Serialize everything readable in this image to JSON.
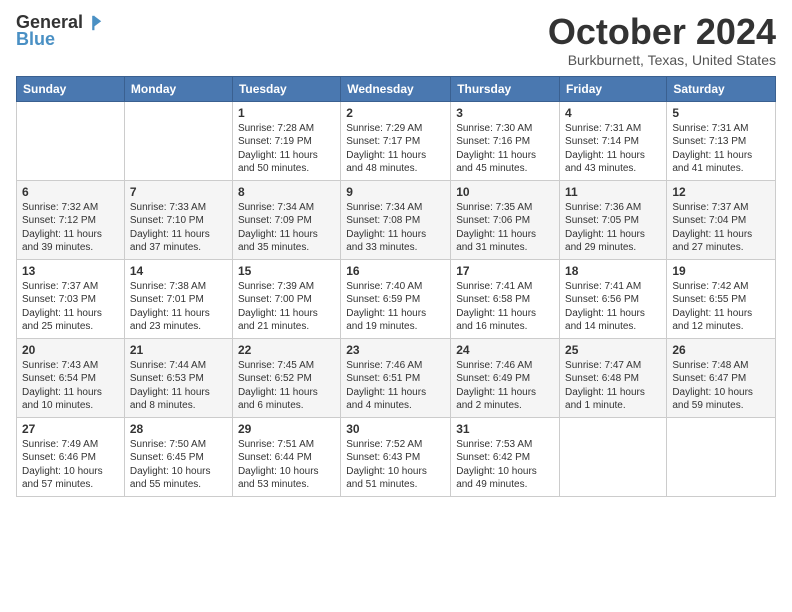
{
  "header": {
    "logo_general": "General",
    "logo_blue": "Blue",
    "main_title": "October 2024",
    "subtitle": "Burkburnett, Texas, United States"
  },
  "calendar": {
    "days_of_week": [
      "Sunday",
      "Monday",
      "Tuesday",
      "Wednesday",
      "Thursday",
      "Friday",
      "Saturday"
    ],
    "weeks": [
      [
        {
          "day": "",
          "info": ""
        },
        {
          "day": "",
          "info": ""
        },
        {
          "day": "1",
          "info": "Sunrise: 7:28 AM\nSunset: 7:19 PM\nDaylight: 11 hours and 50 minutes."
        },
        {
          "day": "2",
          "info": "Sunrise: 7:29 AM\nSunset: 7:17 PM\nDaylight: 11 hours and 48 minutes."
        },
        {
          "day": "3",
          "info": "Sunrise: 7:30 AM\nSunset: 7:16 PM\nDaylight: 11 hours and 45 minutes."
        },
        {
          "day": "4",
          "info": "Sunrise: 7:31 AM\nSunset: 7:14 PM\nDaylight: 11 hours and 43 minutes."
        },
        {
          "day": "5",
          "info": "Sunrise: 7:31 AM\nSunset: 7:13 PM\nDaylight: 11 hours and 41 minutes."
        }
      ],
      [
        {
          "day": "6",
          "info": "Sunrise: 7:32 AM\nSunset: 7:12 PM\nDaylight: 11 hours and 39 minutes."
        },
        {
          "day": "7",
          "info": "Sunrise: 7:33 AM\nSunset: 7:10 PM\nDaylight: 11 hours and 37 minutes."
        },
        {
          "day": "8",
          "info": "Sunrise: 7:34 AM\nSunset: 7:09 PM\nDaylight: 11 hours and 35 minutes."
        },
        {
          "day": "9",
          "info": "Sunrise: 7:34 AM\nSunset: 7:08 PM\nDaylight: 11 hours and 33 minutes."
        },
        {
          "day": "10",
          "info": "Sunrise: 7:35 AM\nSunset: 7:06 PM\nDaylight: 11 hours and 31 minutes."
        },
        {
          "day": "11",
          "info": "Sunrise: 7:36 AM\nSunset: 7:05 PM\nDaylight: 11 hours and 29 minutes."
        },
        {
          "day": "12",
          "info": "Sunrise: 7:37 AM\nSunset: 7:04 PM\nDaylight: 11 hours and 27 minutes."
        }
      ],
      [
        {
          "day": "13",
          "info": "Sunrise: 7:37 AM\nSunset: 7:03 PM\nDaylight: 11 hours and 25 minutes."
        },
        {
          "day": "14",
          "info": "Sunrise: 7:38 AM\nSunset: 7:01 PM\nDaylight: 11 hours and 23 minutes."
        },
        {
          "day": "15",
          "info": "Sunrise: 7:39 AM\nSunset: 7:00 PM\nDaylight: 11 hours and 21 minutes."
        },
        {
          "day": "16",
          "info": "Sunrise: 7:40 AM\nSunset: 6:59 PM\nDaylight: 11 hours and 19 minutes."
        },
        {
          "day": "17",
          "info": "Sunrise: 7:41 AM\nSunset: 6:58 PM\nDaylight: 11 hours and 16 minutes."
        },
        {
          "day": "18",
          "info": "Sunrise: 7:41 AM\nSunset: 6:56 PM\nDaylight: 11 hours and 14 minutes."
        },
        {
          "day": "19",
          "info": "Sunrise: 7:42 AM\nSunset: 6:55 PM\nDaylight: 11 hours and 12 minutes."
        }
      ],
      [
        {
          "day": "20",
          "info": "Sunrise: 7:43 AM\nSunset: 6:54 PM\nDaylight: 11 hours and 10 minutes."
        },
        {
          "day": "21",
          "info": "Sunrise: 7:44 AM\nSunset: 6:53 PM\nDaylight: 11 hours and 8 minutes."
        },
        {
          "day": "22",
          "info": "Sunrise: 7:45 AM\nSunset: 6:52 PM\nDaylight: 11 hours and 6 minutes."
        },
        {
          "day": "23",
          "info": "Sunrise: 7:46 AM\nSunset: 6:51 PM\nDaylight: 11 hours and 4 minutes."
        },
        {
          "day": "24",
          "info": "Sunrise: 7:46 AM\nSunset: 6:49 PM\nDaylight: 11 hours and 2 minutes."
        },
        {
          "day": "25",
          "info": "Sunrise: 7:47 AM\nSunset: 6:48 PM\nDaylight: 11 hours and 1 minute."
        },
        {
          "day": "26",
          "info": "Sunrise: 7:48 AM\nSunset: 6:47 PM\nDaylight: 10 hours and 59 minutes."
        }
      ],
      [
        {
          "day": "27",
          "info": "Sunrise: 7:49 AM\nSunset: 6:46 PM\nDaylight: 10 hours and 57 minutes."
        },
        {
          "day": "28",
          "info": "Sunrise: 7:50 AM\nSunset: 6:45 PM\nDaylight: 10 hours and 55 minutes."
        },
        {
          "day": "29",
          "info": "Sunrise: 7:51 AM\nSunset: 6:44 PM\nDaylight: 10 hours and 53 minutes."
        },
        {
          "day": "30",
          "info": "Sunrise: 7:52 AM\nSunset: 6:43 PM\nDaylight: 10 hours and 51 minutes."
        },
        {
          "day": "31",
          "info": "Sunrise: 7:53 AM\nSunset: 6:42 PM\nDaylight: 10 hours and 49 minutes."
        },
        {
          "day": "",
          "info": ""
        },
        {
          "day": "",
          "info": ""
        }
      ]
    ]
  }
}
